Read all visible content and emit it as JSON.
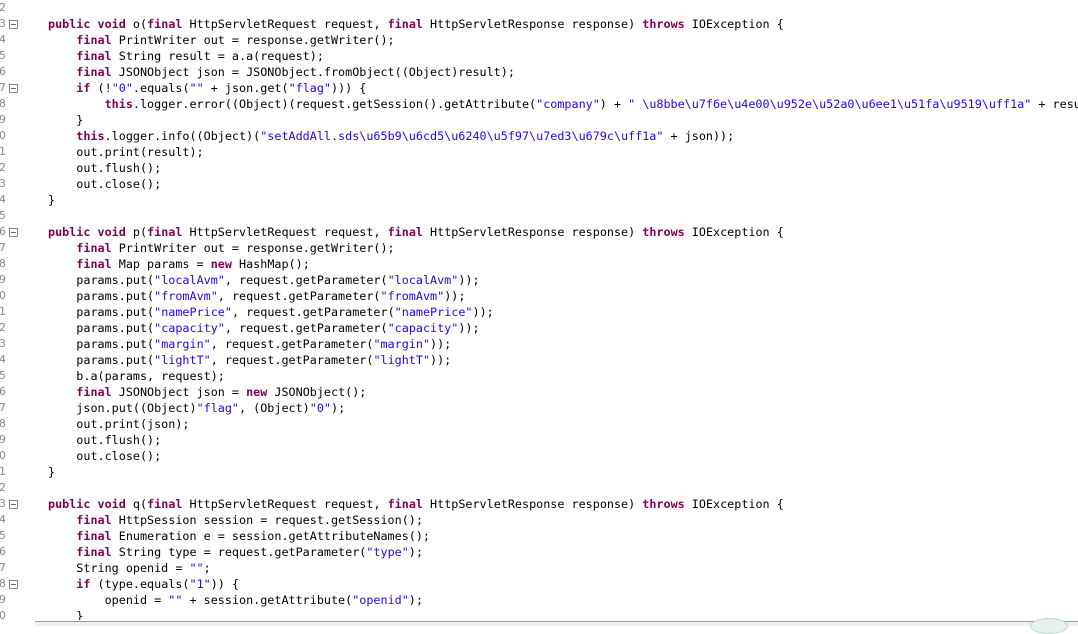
{
  "editor": {
    "colors": {
      "keyword": "#7f0055",
      "string": "#2a00ff",
      "text": "#000000"
    },
    "lines": [
      {
        "num": "2",
        "fold": false,
        "tokens": []
      },
      {
        "num": "3",
        "fold": true,
        "tokens": [
          [
            "k",
            "public void"
          ],
          [
            "p",
            " o("
          ],
          [
            "k",
            "final"
          ],
          [
            "p",
            " HttpServletRequest request, "
          ],
          [
            "k",
            "final"
          ],
          [
            "p",
            " HttpServletResponse response) "
          ],
          [
            "k",
            "throws"
          ],
          [
            "p",
            " IOException {"
          ]
        ]
      },
      {
        "num": "4",
        "fold": false,
        "tokens": [
          [
            "p",
            "    "
          ],
          [
            "k",
            "final"
          ],
          [
            "p",
            " PrintWriter out = response.getWriter();"
          ]
        ]
      },
      {
        "num": "5",
        "fold": false,
        "tokens": [
          [
            "p",
            "    "
          ],
          [
            "k",
            "final"
          ],
          [
            "p",
            " String result = a.a(request);"
          ]
        ]
      },
      {
        "num": "6",
        "fold": false,
        "tokens": [
          [
            "p",
            "    "
          ],
          [
            "k",
            "final"
          ],
          [
            "p",
            " JSONObject json = JSONObject.fromObject((Object)result);"
          ]
        ]
      },
      {
        "num": "7",
        "fold": true,
        "tokens": [
          [
            "p",
            "    "
          ],
          [
            "k",
            "if"
          ],
          [
            "p",
            " (!"
          ],
          [
            "s",
            "\"0\""
          ],
          [
            "p",
            ".equals("
          ],
          [
            "s",
            "\"\""
          ],
          [
            "p",
            " + json.get("
          ],
          [
            "s",
            "\"flag\""
          ],
          [
            "p",
            "))) {"
          ]
        ]
      },
      {
        "num": "8",
        "fold": false,
        "tokens": [
          [
            "p",
            "        "
          ],
          [
            "k",
            "this"
          ],
          [
            "p",
            ".logger.error((Object)(request.getSession().getAttribute("
          ],
          [
            "s",
            "\"company\""
          ],
          [
            "p",
            ") + "
          ],
          [
            "s",
            "\" \\u8bbe\\u7f6e\\u4e00\\u952e\\u52a0\\u6ee1\\u51fa\\u9519\\uff1a\""
          ],
          [
            "p",
            " + result"
          ]
        ]
      },
      {
        "num": "9",
        "fold": false,
        "tokens": [
          [
            "p",
            "    }"
          ]
        ]
      },
      {
        "num": "0",
        "fold": false,
        "tokens": [
          [
            "p",
            "    "
          ],
          [
            "k",
            "this"
          ],
          [
            "p",
            ".logger.info((Object)("
          ],
          [
            "s",
            "\"setAddAll.sds\\u65b9\\u6cd5\\u6240\\u5f97\\u7ed3\\u679c\\uff1a\""
          ],
          [
            "p",
            " + json));"
          ]
        ]
      },
      {
        "num": "1",
        "fold": false,
        "tokens": [
          [
            "p",
            "    out.print(result);"
          ]
        ]
      },
      {
        "num": "2",
        "fold": false,
        "tokens": [
          [
            "p",
            "    out.flush();"
          ]
        ]
      },
      {
        "num": "3",
        "fold": false,
        "tokens": [
          [
            "p",
            "    out.close();"
          ]
        ]
      },
      {
        "num": "4",
        "fold": false,
        "tokens": [
          [
            "p",
            "}"
          ]
        ]
      },
      {
        "num": "5",
        "fold": false,
        "tokens": []
      },
      {
        "num": "6",
        "fold": true,
        "tokens": [
          [
            "k",
            "public void"
          ],
          [
            "p",
            " p("
          ],
          [
            "k",
            "final"
          ],
          [
            "p",
            " HttpServletRequest request, "
          ],
          [
            "k",
            "final"
          ],
          [
            "p",
            " HttpServletResponse response) "
          ],
          [
            "k",
            "throws"
          ],
          [
            "p",
            " IOException {"
          ]
        ]
      },
      {
        "num": "7",
        "fold": false,
        "tokens": [
          [
            "p",
            "    "
          ],
          [
            "k",
            "final"
          ],
          [
            "p",
            " PrintWriter out = response.getWriter();"
          ]
        ]
      },
      {
        "num": "8",
        "fold": false,
        "tokens": [
          [
            "p",
            "    "
          ],
          [
            "k",
            "final"
          ],
          [
            "p",
            " Map params = "
          ],
          [
            "k",
            "new"
          ],
          [
            "p",
            " HashMap();"
          ]
        ]
      },
      {
        "num": "9",
        "fold": false,
        "tokens": [
          [
            "p",
            "    params.put("
          ],
          [
            "s",
            "\"localAvm\""
          ],
          [
            "p",
            ", request.getParameter("
          ],
          [
            "s",
            "\"localAvm\""
          ],
          [
            "p",
            "));"
          ]
        ]
      },
      {
        "num": "0",
        "fold": false,
        "tokens": [
          [
            "p",
            "    params.put("
          ],
          [
            "s",
            "\"fromAvm\""
          ],
          [
            "p",
            ", request.getParameter("
          ],
          [
            "s",
            "\"fromAvm\""
          ],
          [
            "p",
            "));"
          ]
        ]
      },
      {
        "num": "1",
        "fold": false,
        "tokens": [
          [
            "p",
            "    params.put("
          ],
          [
            "s",
            "\"namePrice\""
          ],
          [
            "p",
            ", request.getParameter("
          ],
          [
            "s",
            "\"namePrice\""
          ],
          [
            "p",
            "));"
          ]
        ]
      },
      {
        "num": "2",
        "fold": false,
        "tokens": [
          [
            "p",
            "    params.put("
          ],
          [
            "s",
            "\"capacity\""
          ],
          [
            "p",
            ", request.getParameter("
          ],
          [
            "s",
            "\"capacity\""
          ],
          [
            "p",
            "));"
          ]
        ]
      },
      {
        "num": "3",
        "fold": false,
        "tokens": [
          [
            "p",
            "    params.put("
          ],
          [
            "s",
            "\"margin\""
          ],
          [
            "p",
            ", request.getParameter("
          ],
          [
            "s",
            "\"margin\""
          ],
          [
            "p",
            "));"
          ]
        ]
      },
      {
        "num": "4",
        "fold": false,
        "tokens": [
          [
            "p",
            "    params.put("
          ],
          [
            "s",
            "\"lightT\""
          ],
          [
            "p",
            ", request.getParameter("
          ],
          [
            "s",
            "\"lightT\""
          ],
          [
            "p",
            "));"
          ]
        ]
      },
      {
        "num": "5",
        "fold": false,
        "tokens": [
          [
            "p",
            "    b.a(params, request);"
          ]
        ]
      },
      {
        "num": "6",
        "fold": false,
        "tokens": [
          [
            "p",
            "    "
          ],
          [
            "k",
            "final"
          ],
          [
            "p",
            " JSONObject json = "
          ],
          [
            "k",
            "new"
          ],
          [
            "p",
            " JSONObject();"
          ]
        ]
      },
      {
        "num": "7",
        "fold": false,
        "tokens": [
          [
            "p",
            "    json.put((Object)"
          ],
          [
            "s",
            "\"flag\""
          ],
          [
            "p",
            ", (Object)"
          ],
          [
            "s",
            "\"0\""
          ],
          [
            "p",
            ");"
          ]
        ]
      },
      {
        "num": "8",
        "fold": false,
        "tokens": [
          [
            "p",
            "    out.print(json);"
          ]
        ]
      },
      {
        "num": "9",
        "fold": false,
        "tokens": [
          [
            "p",
            "    out.flush();"
          ]
        ]
      },
      {
        "num": "0",
        "fold": false,
        "tokens": [
          [
            "p",
            "    out.close();"
          ]
        ]
      },
      {
        "num": "1",
        "fold": false,
        "tokens": [
          [
            "p",
            "}"
          ]
        ]
      },
      {
        "num": "2",
        "fold": false,
        "tokens": []
      },
      {
        "num": "3",
        "fold": true,
        "tokens": [
          [
            "k",
            "public void"
          ],
          [
            "p",
            " q("
          ],
          [
            "k",
            "final"
          ],
          [
            "p",
            " HttpServletRequest request, "
          ],
          [
            "k",
            "final"
          ],
          [
            "p",
            " HttpServletResponse response) "
          ],
          [
            "k",
            "throws"
          ],
          [
            "p",
            " IOException {"
          ]
        ]
      },
      {
        "num": "4",
        "fold": false,
        "tokens": [
          [
            "p",
            "    "
          ],
          [
            "k",
            "final"
          ],
          [
            "p",
            " HttpSession session = request.getSession();"
          ]
        ]
      },
      {
        "num": "5",
        "fold": false,
        "tokens": [
          [
            "p",
            "    "
          ],
          [
            "k",
            "final"
          ],
          [
            "p",
            " Enumeration e = session.getAttributeNames();"
          ]
        ]
      },
      {
        "num": "6",
        "fold": false,
        "tokens": [
          [
            "p",
            "    "
          ],
          [
            "k",
            "final"
          ],
          [
            "p",
            " String type = request.getParameter("
          ],
          [
            "s",
            "\"type\""
          ],
          [
            "p",
            ");"
          ]
        ]
      },
      {
        "num": "7",
        "fold": false,
        "tokens": [
          [
            "p",
            "    String openid = "
          ],
          [
            "s",
            "\"\""
          ],
          [
            "p",
            ";"
          ]
        ]
      },
      {
        "num": "8",
        "fold": true,
        "tokens": [
          [
            "p",
            "    "
          ],
          [
            "k",
            "if"
          ],
          [
            "p",
            " (type.equals("
          ],
          [
            "s",
            "\"1\""
          ],
          [
            "p",
            ")) {"
          ]
        ]
      },
      {
        "num": "9",
        "fold": false,
        "tokens": [
          [
            "p",
            "        openid = "
          ],
          [
            "s",
            "\"\""
          ],
          [
            "p",
            " + session.getAttribute("
          ],
          [
            "s",
            "\"openid\""
          ],
          [
            "p",
            ");"
          ]
        ]
      },
      {
        "num": "0",
        "fold": false,
        "tokens": [
          [
            "p",
            "    }"
          ]
        ]
      }
    ]
  }
}
